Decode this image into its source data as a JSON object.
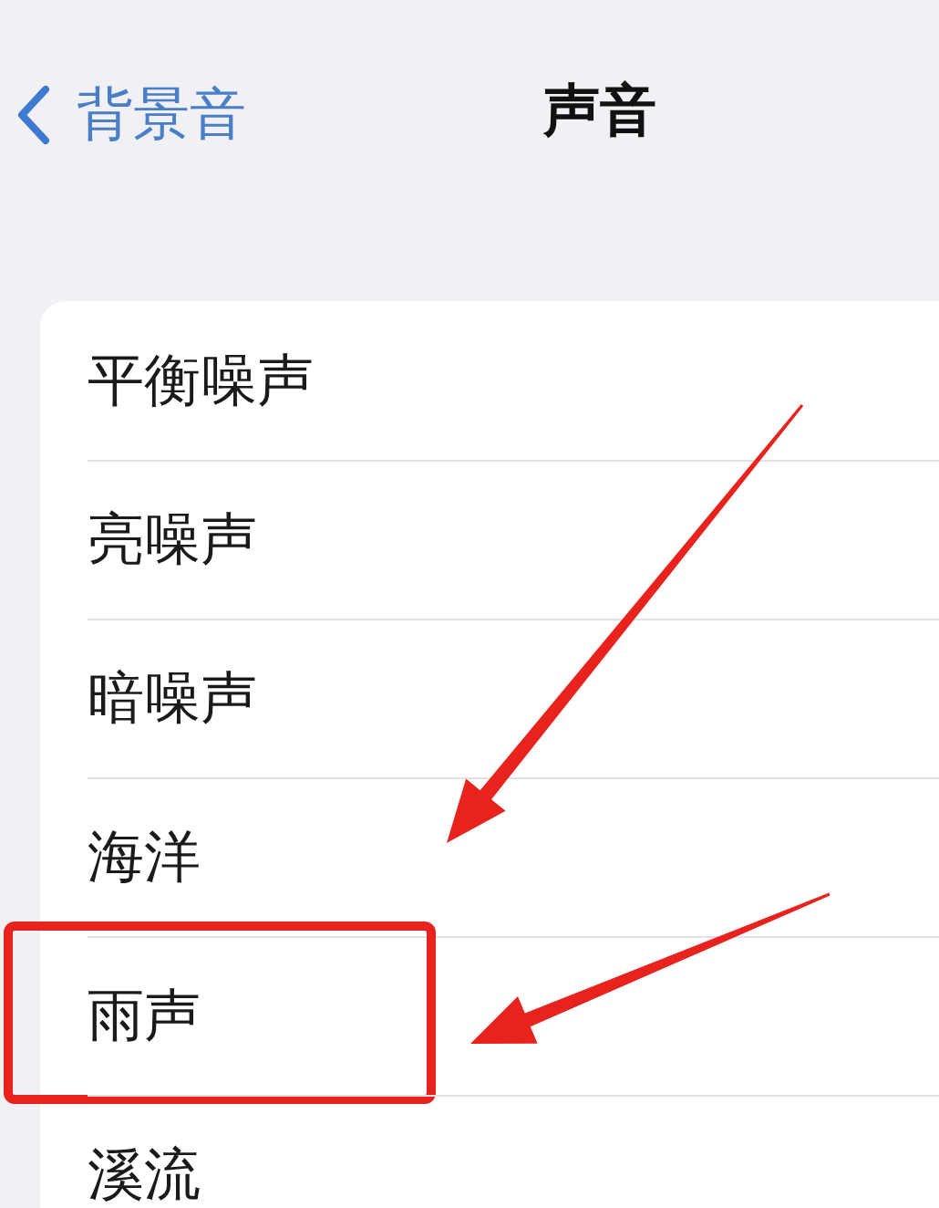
{
  "nav": {
    "back_label": "背景音",
    "title": "声音"
  },
  "sounds": [
    {
      "label": "平衡噪声",
      "highlighted": false
    },
    {
      "label": "亮噪声",
      "highlighted": false
    },
    {
      "label": "暗噪声",
      "highlighted": false
    },
    {
      "label": "海洋",
      "highlighted": false
    },
    {
      "label": "雨声",
      "highlighted": true
    },
    {
      "label": "溪流",
      "highlighted": false
    }
  ],
  "annotations": [
    {
      "kind": "arrow"
    },
    {
      "kind": "arrow"
    }
  ]
}
